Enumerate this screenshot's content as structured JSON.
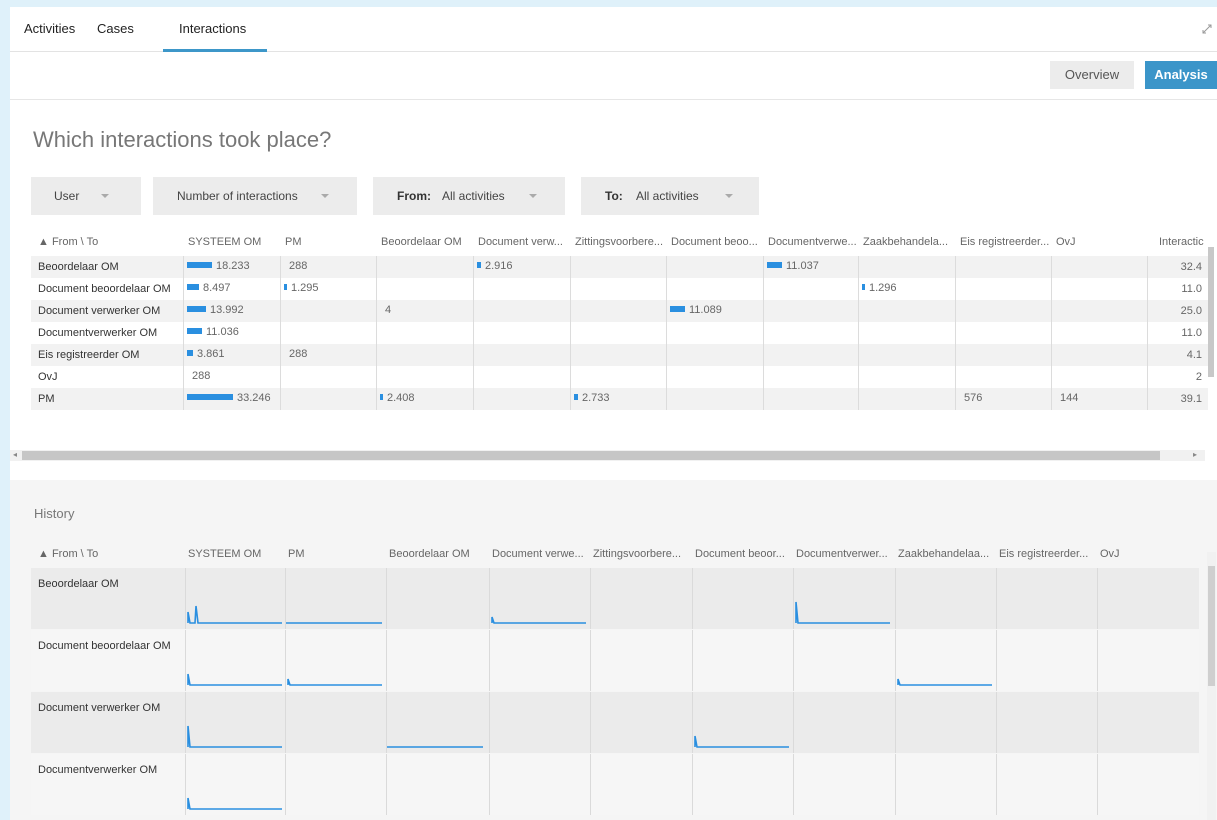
{
  "tabs": [
    {
      "label": "Activities"
    },
    {
      "label": "Cases"
    },
    {
      "label": "Interactions",
      "active": true
    }
  ],
  "view_toggle": {
    "overview": "Overview",
    "analysis": "Analysis",
    "active": "Analysis"
  },
  "heading": "Which interactions took place?",
  "filters": {
    "group_by": "User",
    "measure": "Number of interactions",
    "from_label": "From:",
    "from_value": "All activities",
    "to_label": "To:",
    "to_value": "All activities"
  },
  "table": {
    "corner": "▲ From \\ To",
    "columns": [
      "SYSTEEM OM",
      "PM",
      "Beoordelaar OM",
      "Document verw...",
      "Zittingsvoorbere...",
      "Document beoo...",
      "Documentverwe...",
      "Zaakbehandela...",
      "Eis registreerder...",
      "OvJ"
    ],
    "total_header": "Interactic",
    "rows": [
      {
        "label": "Beoordelaar OM",
        "cells": [
          "18.233",
          "288",
          "",
          "2.916",
          "",
          "",
          "11.037",
          "",
          "",
          ""
        ],
        "bars": [
          0.55,
          0,
          0,
          0.09,
          0,
          0,
          0.33,
          0,
          0,
          0
        ],
        "total": "32.4"
      },
      {
        "label": "Document beoordelaar OM",
        "cells": [
          "8.497",
          "1.295",
          "",
          "",
          "",
          "",
          "",
          "1.296",
          "",
          ""
        ],
        "bars": [
          0.26,
          0.04,
          0,
          0,
          0,
          0,
          0,
          0.04,
          0,
          0
        ],
        "total": "11.0"
      },
      {
        "label": "Document verwerker OM",
        "cells": [
          "13.992",
          "",
          "4",
          "",
          "",
          "11.089",
          "",
          "",
          "",
          ""
        ],
        "bars": [
          0.42,
          0,
          0,
          0,
          0,
          0.33,
          0,
          0,
          0,
          0
        ],
        "total": "25.0"
      },
      {
        "label": "Documentverwerker OM",
        "cells": [
          "11.036",
          "",
          "",
          "",
          "",
          "",
          "",
          "",
          "",
          ""
        ],
        "bars": [
          0.33,
          0,
          0,
          0,
          0,
          0,
          0,
          0,
          0,
          0
        ],
        "total": "11.0"
      },
      {
        "label": "Eis registreerder OM",
        "cells": [
          "3.861",
          "288",
          "",
          "",
          "",
          "",
          "",
          "",
          "",
          ""
        ],
        "bars": [
          0.12,
          0,
          0,
          0,
          0,
          0,
          0,
          0,
          0,
          0
        ],
        "total": "4.1"
      },
      {
        "label": "OvJ",
        "cells": [
          "288",
          "",
          "",
          "",
          "",
          "",
          "",
          "",
          "",
          ""
        ],
        "bars": [
          0,
          0,
          0,
          0,
          0,
          0,
          0,
          0,
          0,
          0
        ],
        "total": "2"
      },
      {
        "label": "PM",
        "cells": [
          "33.246",
          "",
          "2.408",
          "",
          "2.733",
          "",
          "",
          "",
          "576",
          "144"
        ],
        "bars": [
          1.0,
          0,
          0.07,
          0,
          0.08,
          0,
          0,
          0,
          0,
          0
        ],
        "total": "39.1"
      }
    ]
  },
  "history": {
    "title": "History",
    "corner": "▲ From \\ To",
    "columns": [
      "SYSTEEM OM",
      "PM",
      "Beoordelaar OM",
      "Document verwe...",
      "Zittingsvoorbere...",
      "Document beoor...",
      "Documentverwer...",
      "Zaakbehandelaa...",
      "Eis registreerder...",
      "OvJ"
    ],
    "rows": [
      {
        "label": "Beoordelaar OM",
        "sparks": [
          "spike2",
          "flat",
          "",
          "step-small",
          "",
          "",
          "step",
          "",
          "",
          ""
        ]
      },
      {
        "label": "Document beoordelaar OM",
        "sparks": [
          "step-mid",
          "step-small",
          "",
          "",
          "",
          "",
          "",
          "step-small",
          "",
          ""
        ]
      },
      {
        "label": "Document verwerker OM",
        "sparks": [
          "step",
          "",
          "flat",
          "",
          "",
          "step-mid",
          "",
          "",
          "",
          ""
        ]
      },
      {
        "label": "Documentverwerker OM",
        "sparks": [
          "step-mid",
          "",
          "",
          "",
          "",
          "",
          "",
          "",
          "",
          ""
        ]
      }
    ]
  },
  "colors": {
    "accent": "#3b95c9",
    "bar": "#2a8fe0",
    "spark": "#2a8fe0"
  },
  "icons": {
    "expand": "expand-icon",
    "caret": "chevron-down-icon"
  }
}
